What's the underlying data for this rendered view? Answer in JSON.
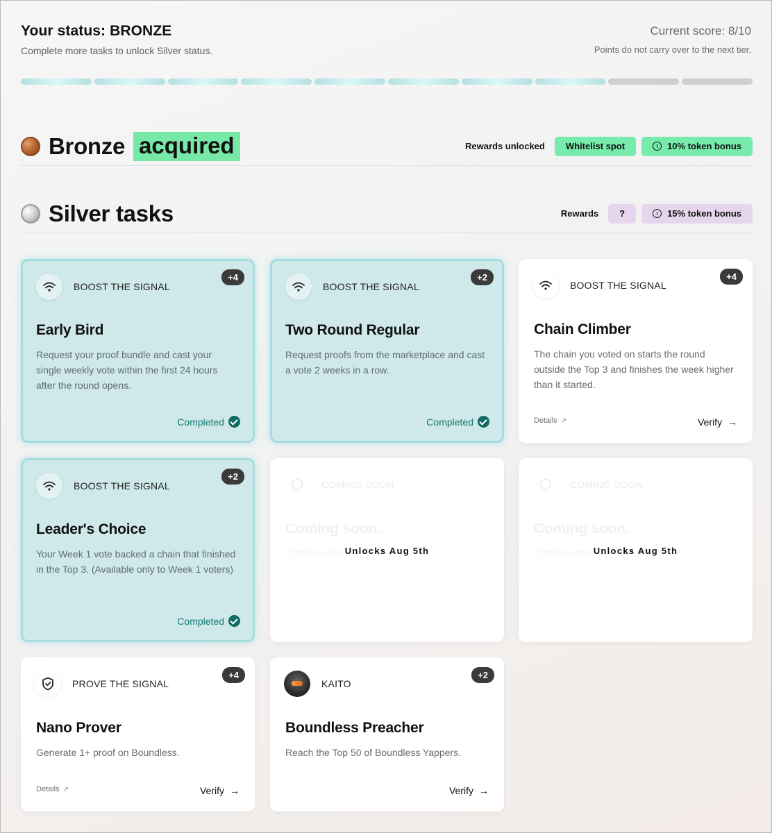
{
  "status": {
    "title": "Your status: BRONZE",
    "subtitle": "Complete more tasks to unlock Silver status.",
    "score_label": "Current score: 8/10",
    "note": "Points do not carry over to the next tier.",
    "progress_filled": 8,
    "progress_total": 10
  },
  "bronze": {
    "title": "Bronze",
    "tag": "acquired",
    "rewards_label": "Rewards unlocked",
    "rewards": [
      "Whitelist spot",
      "10% token bonus"
    ]
  },
  "silver": {
    "title": "Silver tasks",
    "rewards_label": "Rewards",
    "rewards": [
      "?",
      "15% token bonus"
    ]
  },
  "cards": [
    {
      "category": "BOOST THE SIGNAL",
      "points": "+4",
      "title": "Early Bird",
      "desc": "Request your proof bundle and cast your single weekly vote within the first 24 hours after the round opens.",
      "status": "Completed"
    },
    {
      "category": "BOOST THE SIGNAL",
      "points": "+2",
      "title": "Two Round Regular",
      "desc": "Request proofs from the marketplace and cast a vote 2 weeks in a row.",
      "status": "Completed"
    },
    {
      "category": "BOOST THE SIGNAL",
      "points": "+4",
      "title": "Chain Climber",
      "desc": "The chain you voted on starts the round outside the Top 3 and finishes the week higher than it started.",
      "details": "Details",
      "action": "Verify"
    },
    {
      "category": "BOOST THE SIGNAL",
      "points": "+2",
      "title": "Leader's Choice",
      "desc": "Your Week 1 vote backed a chain that finished in the Top 3. (Available only to Week 1 voters)",
      "status": "Completed"
    },
    {
      "category": "COMING SOON",
      "title": "Coming soon.",
      "ghost": "Coming soon",
      "unlock": "Unlocks Aug 5th"
    },
    {
      "category": "COMING SOON",
      "title": "Coming soon.",
      "ghost": "Coming soon",
      "unlock": "Unlocks Aug 5th"
    },
    {
      "category": "PROVE THE SIGNAL",
      "points": "+4",
      "title": "Nano Prover",
      "desc": "Generate 1+ proof on Boundless.",
      "details": "Details",
      "action": "Verify"
    },
    {
      "category": "KAITO",
      "points": "+2",
      "title": "Boundless Preacher",
      "desc": "Reach the Top 50 of Boundless Yappers.",
      "action": "Verify"
    }
  ],
  "icons": {
    "wifi": "wifi-icon",
    "shield": "shield-check-icon",
    "check": "check-circle-icon",
    "arrow": "arrow-right-icon",
    "external": "external-link-icon"
  }
}
